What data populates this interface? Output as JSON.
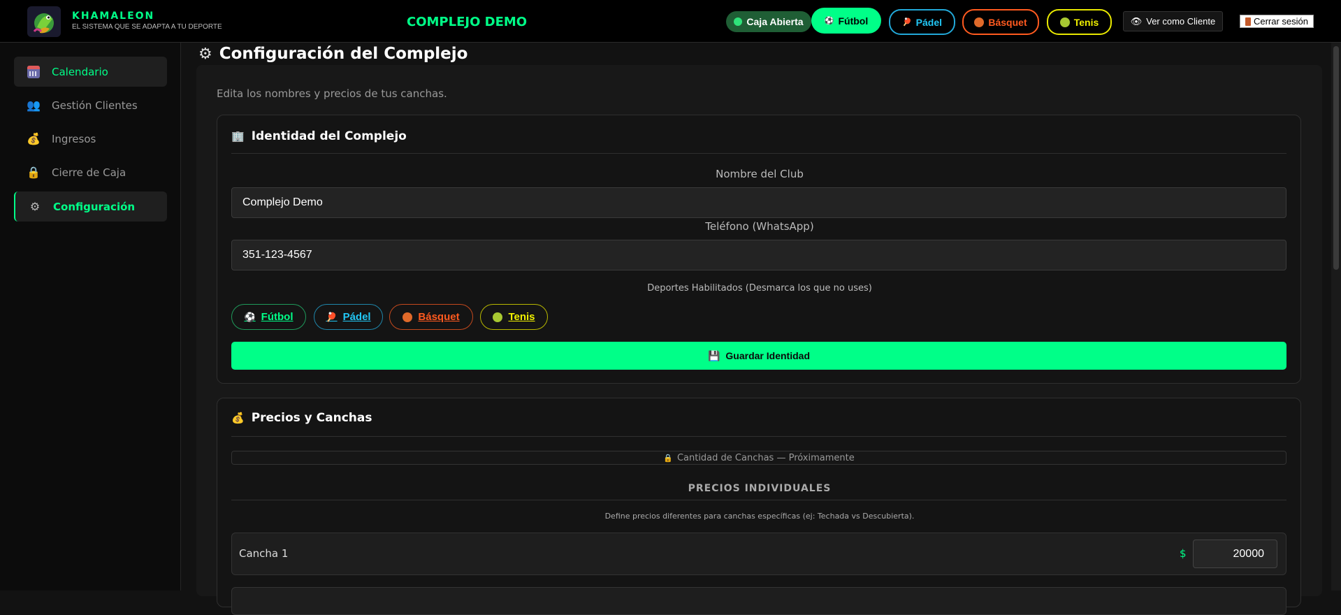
{
  "header": {
    "brand_name": "KHAMALEON",
    "brand_tagline": "EL SISTEMA QUE SE ADAPTA A TU DEPORTE",
    "club_title": "COMPLEJO DEMO",
    "caja_label": "Caja Abierta",
    "sports": [
      "Fútbol",
      "Pádel",
      "Básquet",
      "Tenis"
    ],
    "client_view_label": "Ver como Cliente",
    "logout_label": "Cerrar sesión"
  },
  "sidebar": {
    "items": [
      {
        "label": "Calendario",
        "icon": "calendar-icon"
      },
      {
        "label": "Gestión Clientes",
        "icon": "users-icon"
      },
      {
        "label": "Ingresos",
        "icon": "money-bag-icon"
      },
      {
        "label": "Cierre de Caja",
        "icon": "lock-icon"
      },
      {
        "label": "Configuración",
        "icon": "gear-icon"
      }
    ]
  },
  "main": {
    "title": "Configuración del Complejo",
    "intro": "Edita los nombres y precios de tus canchas.",
    "identity": {
      "heading": "Identidad del Complejo",
      "club_name_label": "Nombre del Club",
      "club_name_value": "Complejo Demo",
      "phone_label": "Teléfono (WhatsApp)",
      "phone_value": "351-123-4567",
      "sports_label": "Deportes Habilitados (Desmarca los que no uses)",
      "sports": [
        "Fútbol",
        "Pádel",
        "Básquet",
        "Tenis"
      ],
      "save_label": "Guardar Identidad"
    },
    "pricing": {
      "heading": "Precios y Canchas",
      "coming_soon": "Cantidad de Canchas — Próximamente",
      "section_title": "PRECIOS INDIVIDUALES",
      "section_desc": "Define precios diferentes para canchas específicas (ej: Techada vs Descubierta).",
      "currency": "$",
      "courts": [
        {
          "name": "Cancha 1",
          "price": "20000"
        }
      ]
    }
  },
  "colors": {
    "accent": "#00ff88",
    "padel": "#22c7f5",
    "basquet": "#ff5a1f",
    "tenis": "#f0f000"
  }
}
